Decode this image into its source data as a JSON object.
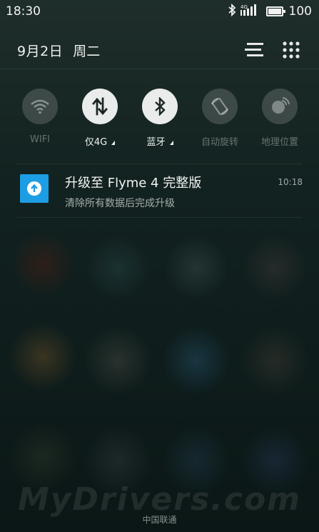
{
  "status_bar": {
    "time": "18:30",
    "network_type": "4G",
    "battery_level": "100"
  },
  "header": {
    "date": "9月2日",
    "weekday": "周二",
    "list_icon": "notification-list-icon",
    "grid_icon": "app-grid-icon"
  },
  "toggles": [
    {
      "label": "WIFI",
      "icon": "wifi-icon",
      "on": false
    },
    {
      "label": "仅4G",
      "icon": "mobile-data-icon",
      "on": true
    },
    {
      "label": "蓝牙",
      "icon": "bluetooth-icon",
      "on": true
    },
    {
      "label": "自动旋转",
      "icon": "auto-rotate-icon",
      "on": false
    },
    {
      "label": "地理位置",
      "icon": "location-icon",
      "on": false
    }
  ],
  "notification": {
    "title": "升级至 Flyme 4 完整版",
    "body": "清除所有数据后完成升级",
    "time": "10:18",
    "icon": "system-update-icon",
    "icon_color": "#1d9de3"
  },
  "watermark": "MyDrivers.com",
  "carrier": "中国联通"
}
